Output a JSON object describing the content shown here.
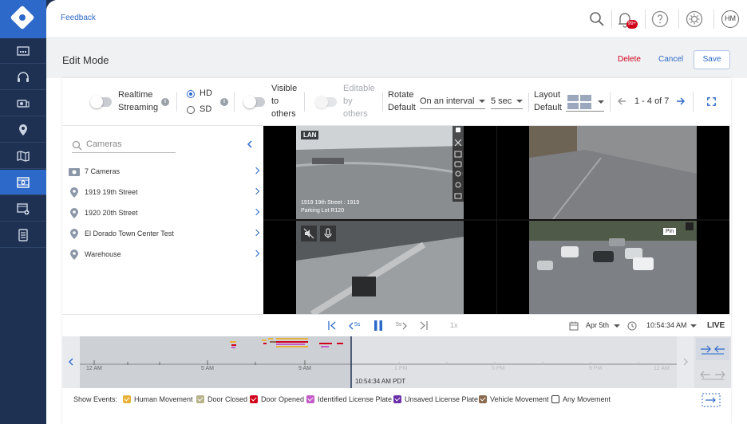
{
  "topbar": {
    "feedback": "Feedback",
    "notifications_badge": "99+",
    "avatar_initials": "HM"
  },
  "editbar": {
    "title": "Edit Mode",
    "delete": "Delete",
    "cancel": "Cancel",
    "save": "Save"
  },
  "toolbar": {
    "realtime_label_1": "Realtime",
    "realtime_label_2": "Streaming",
    "hd": "HD",
    "sd": "SD",
    "visible_1": "Visible",
    "visible_2": "to",
    "visible_3": "others",
    "editable_1": "Editable",
    "editable_2": "by",
    "editable_3": "others",
    "rotate_1": "Rotate",
    "rotate_2": "Default",
    "interval_value": "On an interval",
    "seconds_value": "5 sec",
    "layout_1": "Layout",
    "layout_2": "Default",
    "pager": "1 - 4 of 7"
  },
  "cameras": {
    "search_placeholder": "Cameras",
    "items": [
      {
        "label": "7 Cameras"
      },
      {
        "label": "1919 19th Street"
      },
      {
        "label": "1920 20th Street"
      },
      {
        "label": "El Dorado Town Center Test"
      },
      {
        "label": "Warehouse"
      }
    ]
  },
  "tiles": {
    "lan_badge": "LAN",
    "cam1_caption_1": "1919 19th Street : 1919",
    "cam1_caption_2": "Parking Lot R120",
    "pin_tooltip": "Pin"
  },
  "playback": {
    "back5": "5s",
    "fwd5": "5s",
    "speed": "1x",
    "date": "Apr 5th",
    "time": "10:54:34 AM",
    "live": "LIVE"
  },
  "timeline": {
    "ticks": [
      "12 AM",
      "5 AM",
      "9 AM",
      "1 PM",
      "5 PM",
      "9 PM",
      "12 AM"
    ],
    "cursor_time": "10:54:34 AM PDT"
  },
  "events": {
    "label": "Show Events:",
    "items": [
      {
        "label": "Human Movement",
        "color": "#e8b23a"
      },
      {
        "label": "Door Closed",
        "color": "#b7b38a"
      },
      {
        "label": "Door Opened",
        "color": "#d0021b"
      },
      {
        "label": "Identified License Plate",
        "color": "#c45bc7"
      },
      {
        "label": "Unsaved License Plate",
        "color": "#6b2fa8"
      },
      {
        "label": "Vehicle Movement",
        "color": "#8a6a4f"
      },
      {
        "label": "Any Movement",
        "color": "#ffffff"
      }
    ]
  }
}
